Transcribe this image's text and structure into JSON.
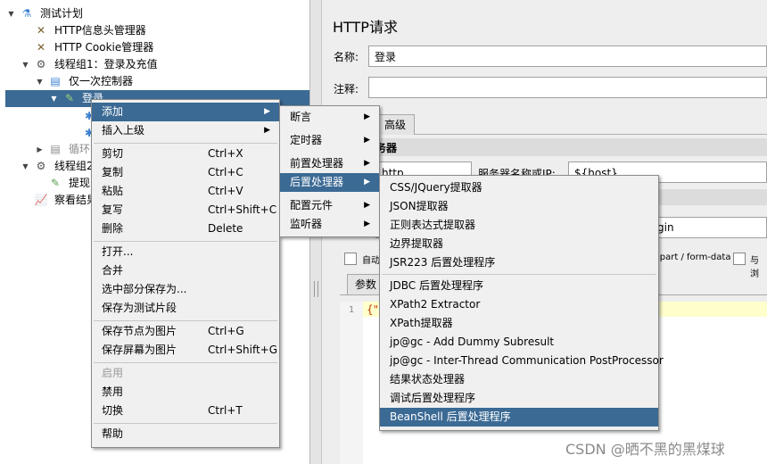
{
  "tree": {
    "items": [
      {
        "label": "测试计划",
        "icon": "flask-icon"
      },
      {
        "label": "HTTP信息头管理器",
        "icon": "wrench-icon"
      },
      {
        "label": "HTTP Cookie管理器",
        "icon": "wrench-icon"
      },
      {
        "label": "线程组1：登录及充值",
        "icon": "gear-icon"
      },
      {
        "label": "仅一次控制器",
        "icon": "controller-icon"
      },
      {
        "label": "登录",
        "icon": "pipette-icon"
      },
      {
        "label": "循环",
        "icon": "controller-icon"
      },
      {
        "label": "线程组2",
        "icon": "gear-icon"
      },
      {
        "label": "提现",
        "icon": "pipette-icon"
      },
      {
        "label": "察看结果",
        "icon": "chart-icon"
      }
    ]
  },
  "panel": {
    "title": "HTTP请求",
    "name_label": "名称:",
    "name_value": "登录",
    "comment_label": "注释:",
    "tab_advanced": "高级",
    "server_section": "务器",
    "protocol_value": "http",
    "server_label": "服务器名称或IP:",
    "server_value": "${host}",
    "path_fragment": "gin",
    "auto_checkbox": "自动",
    "multipart_text": "ipart / form-data",
    "browser_checkbox": "与浏",
    "params_tab": "参数",
    "code_line_number": "1",
    "code_fragment": "{\""
  },
  "context_menu": {
    "items": [
      {
        "label": "添加",
        "shortcut": "",
        "submenu": true
      },
      {
        "label": "插入上级",
        "shortcut": "",
        "submenu": true
      },
      {
        "label": "剪切",
        "shortcut": "Ctrl+X"
      },
      {
        "label": "复制",
        "shortcut": "Ctrl+C"
      },
      {
        "label": "粘贴",
        "shortcut": "Ctrl+V"
      },
      {
        "label": "复写",
        "shortcut": "Ctrl+Shift+C"
      },
      {
        "label": "删除",
        "shortcut": "Delete"
      },
      {
        "label": "打开...",
        "shortcut": ""
      },
      {
        "label": "合并",
        "shortcut": ""
      },
      {
        "label": "选中部分保存为...",
        "shortcut": ""
      },
      {
        "label": "保存为测试片段",
        "shortcut": ""
      },
      {
        "label": "保存节点为图片",
        "shortcut": "Ctrl+G"
      },
      {
        "label": "保存屏幕为图片",
        "shortcut": "Ctrl+Shift+G"
      },
      {
        "label": "启用",
        "shortcut": "",
        "disabled": true
      },
      {
        "label": "禁用",
        "shortcut": ""
      },
      {
        "label": "切换",
        "shortcut": "Ctrl+T"
      },
      {
        "label": "帮助",
        "shortcut": ""
      }
    ]
  },
  "add_submenu": {
    "items": [
      "断言",
      "定时器",
      "前置处理器",
      "后置处理器",
      "配置元件",
      "监听器"
    ]
  },
  "postprocessor_submenu": {
    "items": [
      "CSS/JQuery提取器",
      "JSON提取器",
      "正则表达式提取器",
      "边界提取器",
      "JSR223 后置处理程序",
      "JDBC 后置处理程序",
      "XPath2 Extractor",
      "XPath提取器",
      "jp@gc - Add Dummy Subresult",
      "jp@gc - Inter-Thread Communication PostProcessor",
      "结果状态处理器",
      "调试后置处理程序",
      "BeanShell 后置处理程序"
    ]
  },
  "watermark": "CSDN @晒不黑的黑煤球",
  "colors": {
    "selection": "#3b6a94",
    "menu_bg": "#f0f0f0",
    "editor_highlight": "#ffffcc"
  }
}
